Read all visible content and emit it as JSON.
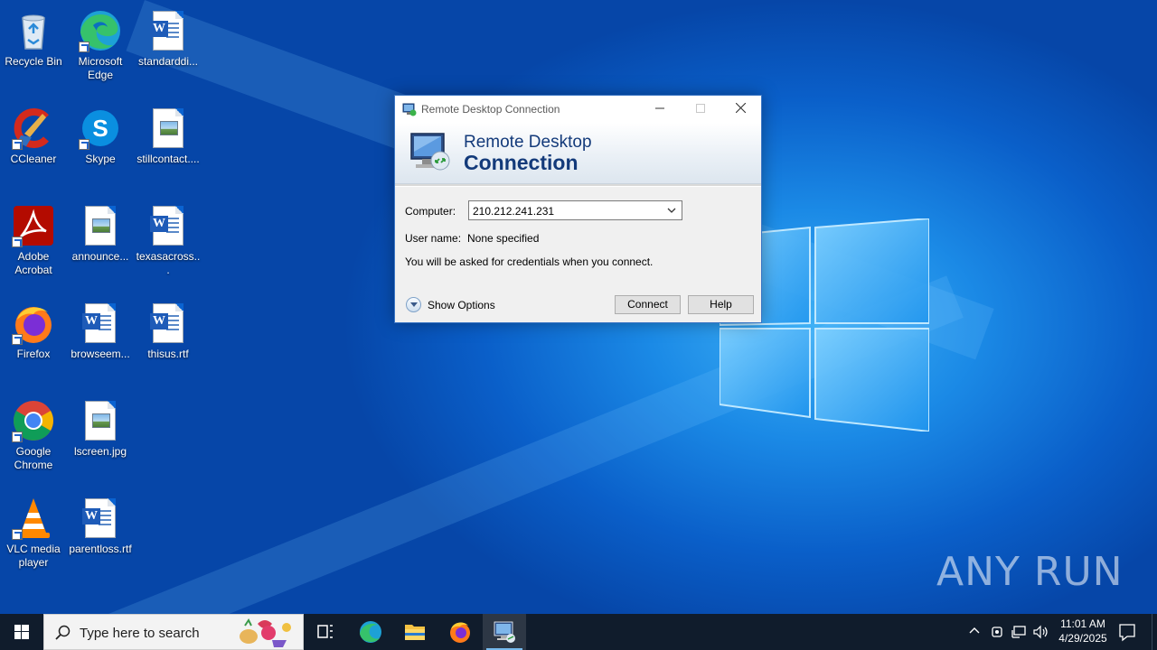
{
  "desktop": {
    "icons": [
      {
        "label": "Recycle Bin",
        "icon": "recycle-bin-icon"
      },
      {
        "label": "Microsoft Edge",
        "icon": "edge-icon"
      },
      {
        "label": "standarddi...",
        "icon": "word-doc-icon"
      },
      {
        "label": "CCleaner",
        "icon": "ccleaner-icon"
      },
      {
        "label": "Skype",
        "icon": "skype-icon"
      },
      {
        "label": "stillcontact....",
        "icon": "image-file-icon"
      },
      {
        "label": "Adobe Acrobat",
        "icon": "acrobat-icon"
      },
      {
        "label": "announce...",
        "icon": "image-file-icon"
      },
      {
        "label": "texasacross...",
        "icon": "word-doc-icon"
      },
      {
        "label": "Firefox",
        "icon": "firefox-icon"
      },
      {
        "label": "browseem...",
        "icon": "word-doc-icon"
      },
      {
        "label": "thisus.rtf",
        "icon": "word-doc-icon"
      },
      {
        "label": "Google Chrome",
        "icon": "chrome-icon"
      },
      {
        "label": "lscreen.jpg",
        "icon": "image-file-icon"
      },
      {
        "label": "VLC media player",
        "icon": "vlc-icon"
      },
      {
        "label": "parentloss.rtf",
        "icon": "word-doc-icon"
      }
    ]
  },
  "rdc": {
    "title": "Remote Desktop Connection",
    "banner_line1": "Remote Desktop",
    "banner_line2": "Connection",
    "computer_label": "Computer:",
    "computer_value": "210.212.241.231",
    "username_label": "User name:",
    "username_value": "None specified",
    "info": "You will be asked for credentials when you connect.",
    "show_options": "Show Options",
    "connect": "Connect",
    "help": "Help"
  },
  "taskbar": {
    "search_placeholder": "Type here to search",
    "time": "11:01 AM",
    "date": "4/29/2025"
  },
  "watermark": "ANY RUN",
  "colors": {
    "accent": "#0a63d1",
    "taskbar": "#101c2c",
    "window_border": "#3a75c4",
    "banner_text": "#133a7a"
  }
}
